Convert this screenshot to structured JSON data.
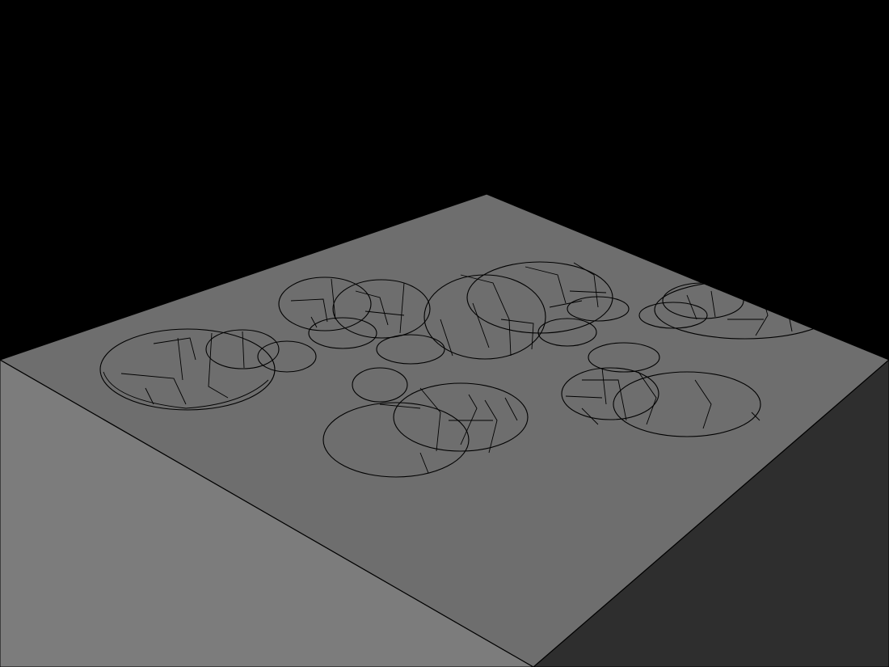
{
  "scene": {
    "background_color": "#000000",
    "top_face_color": "#6e6e6e",
    "front_face_color": "#7a7a7a",
    "right_face_color": "#2e2e2e",
    "cavity_light_color": "#d2d2d2",
    "cavity_dark_color": "#2a2a2a",
    "edge_color": "#000000",
    "cavity_count": 6
  }
}
